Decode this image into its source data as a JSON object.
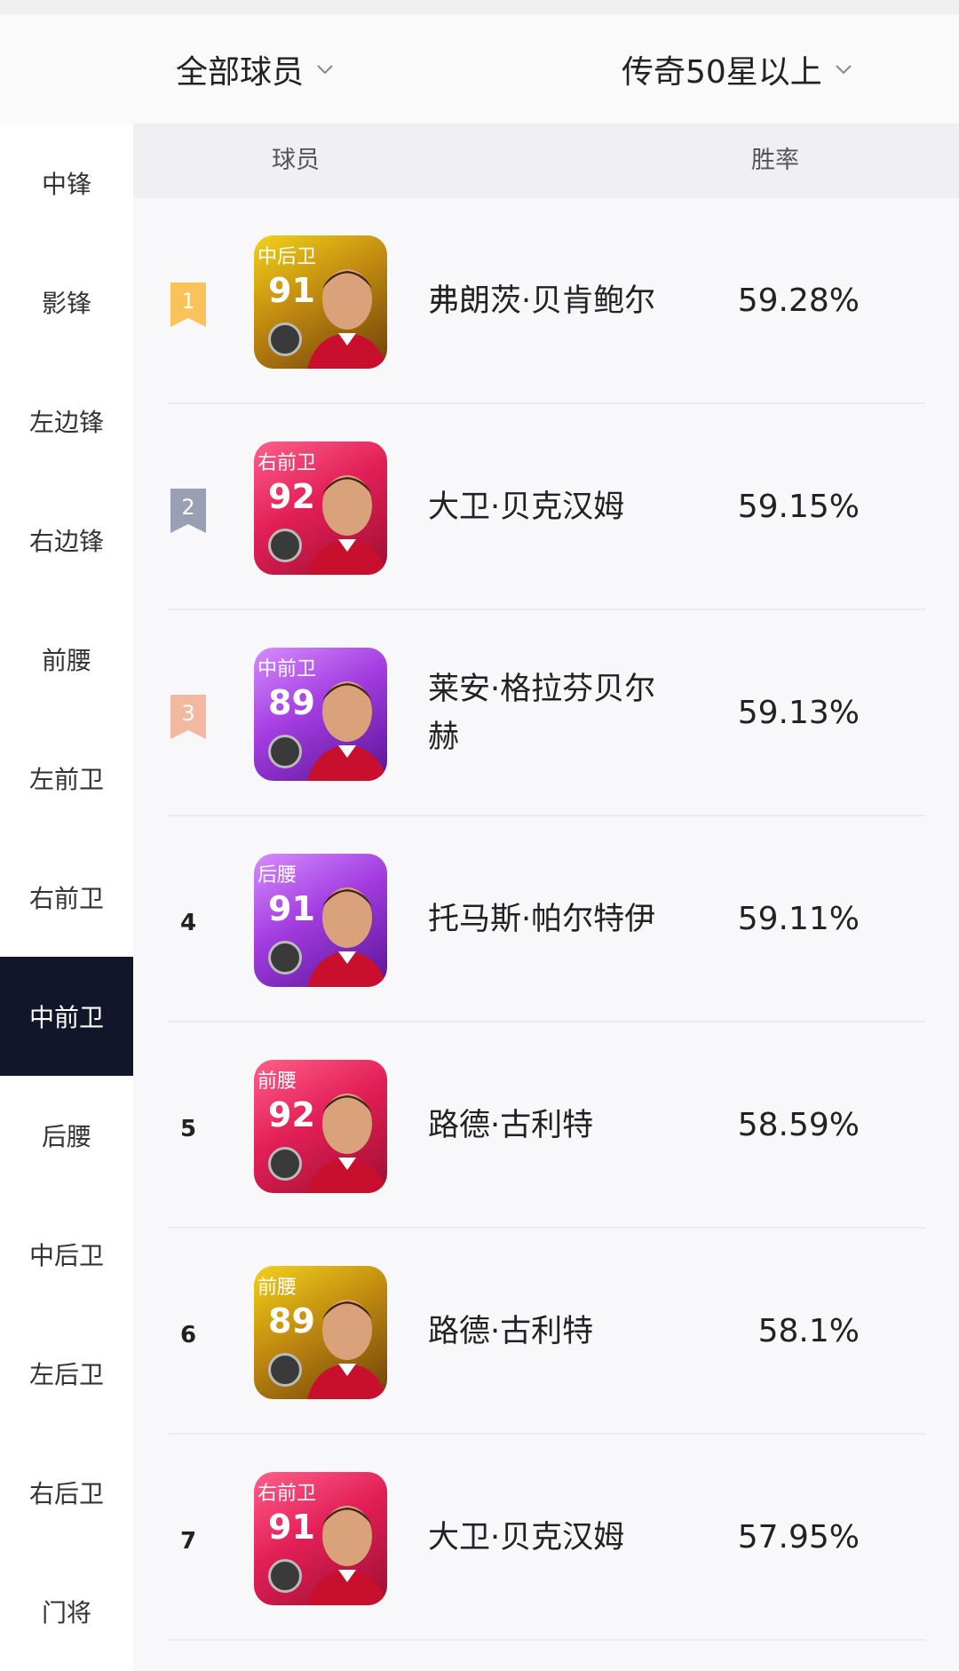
{
  "filters": {
    "left": "全部球员",
    "right": "传奇50星以上"
  },
  "table": {
    "col_player": "球员",
    "col_rate": "胜率"
  },
  "sidebar": {
    "items": [
      {
        "label": "中锋"
      },
      {
        "label": "影锋"
      },
      {
        "label": "左边锋"
      },
      {
        "label": "右边锋"
      },
      {
        "label": "前腰"
      },
      {
        "label": "左前卫"
      },
      {
        "label": "右前卫"
      },
      {
        "label": "中前卫"
      },
      {
        "label": "后腰"
      },
      {
        "label": "中后卫"
      },
      {
        "label": "左后卫"
      },
      {
        "label": "右后卫"
      },
      {
        "label": "门将"
      }
    ],
    "active_index": 7
  },
  "rows": [
    {
      "rank": "1",
      "position": "中后卫",
      "rating": "91",
      "name": "弗朗茨·贝肯鲍尔",
      "win_rate": "59.28%",
      "card_color": "gold",
      "rank_style": "gold"
    },
    {
      "rank": "2",
      "position": "右前卫",
      "rating": "92",
      "name": "大卫·贝克汉姆",
      "win_rate": "59.15%",
      "card_color": "red",
      "rank_style": "silver"
    },
    {
      "rank": "3",
      "position": "中前卫",
      "rating": "89",
      "name": "莱安·格拉芬贝尔赫",
      "win_rate": "59.13%",
      "card_color": "purple",
      "rank_style": "bronze"
    },
    {
      "rank": "4",
      "position": "后腰",
      "rating": "91",
      "name": "托马斯·帕尔特伊",
      "win_rate": "59.11%",
      "card_color": "purple",
      "rank_style": "plain"
    },
    {
      "rank": "5",
      "position": "前腰",
      "rating": "92",
      "name": "路德·古利特",
      "win_rate": "58.59%",
      "card_color": "red",
      "rank_style": "plain"
    },
    {
      "rank": "6",
      "position": "前腰",
      "rating": "89",
      "name": "路德·古利特",
      "win_rate": "58.1%",
      "card_color": "gold",
      "rank_style": "plain"
    },
    {
      "rank": "7",
      "position": "右前卫",
      "rating": "91",
      "name": "大卫·贝克汉姆",
      "win_rate": "57.95%",
      "card_color": "red",
      "rank_style": "plain"
    }
  ],
  "colors": {
    "gold_flag": "#f9c25a",
    "silver_flag": "#9aa0b4",
    "bronze_flag": "#f2b9a0",
    "sidebar_active_bg": "#12162b"
  }
}
